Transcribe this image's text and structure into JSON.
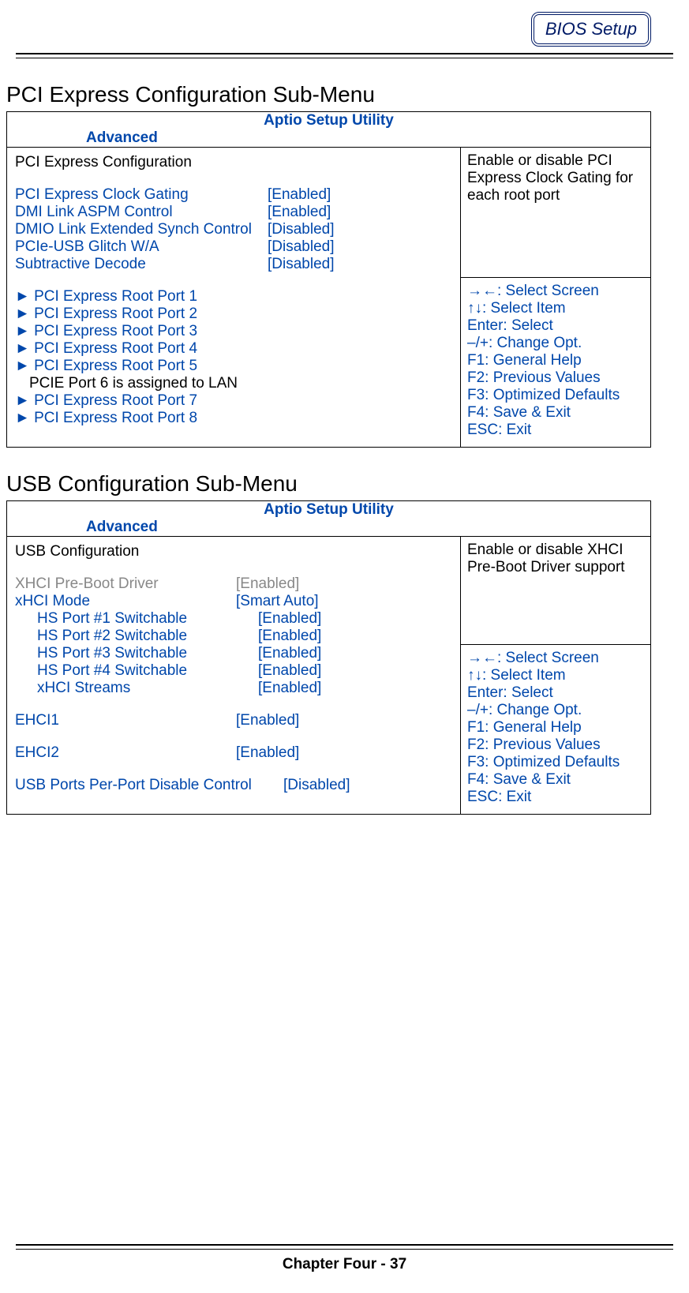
{
  "header": {
    "badge": "BIOS Setup"
  },
  "section1": {
    "title": "PCI Express Configuration Sub-Menu",
    "utility_title": "Aptio Setup Utility",
    "tab": "Advanced",
    "subtitle": "PCI Express Configuration",
    "items": {
      "clock_gating": {
        "label": "PCI Express Clock Gating",
        "value": "[Enabled]"
      },
      "dmi_aspm": {
        "label": "DMI Link ASPM Control",
        "value": "[Enabled]"
      },
      "dmio_ext": {
        "label": "DMIO Link Extended Synch Control",
        "value": "[Disabled]"
      },
      "pcie_usb": {
        "label": "PCIe-USB Glitch W/A",
        "value": "[Disabled]"
      },
      "subtractive": {
        "label": "Subtractive Decode",
        "value": "[Disabled]"
      },
      "port1": "► PCI Express Root Port 1",
      "port2": "► PCI Express Root Port 2",
      "port3": "► PCI Express Root Port 3",
      "port4": "► PCI Express Root Port 4",
      "port5": "► PCI Express Root Port 5",
      "port6": "PCIE Port 6 is assigned to LAN",
      "port7": "► PCI Express Root Port 7",
      "port8": "► PCI Express Root Port 8"
    },
    "help": "Enable or disable PCI Express Clock Gating for each root port",
    "hints": {
      "screen": "→←: Select Screen",
      "item": "↑↓: Select Item",
      "select": "Enter: Select",
      "change": "–/+: Change Opt.",
      "f1": "F1: General Help",
      "f2": "F2: Previous Values",
      "f3": "F3: Optimized Defaults",
      "f4": "F4: Save & Exit",
      "esc": "ESC: Exit"
    }
  },
  "section2": {
    "title": "USB Configuration Sub-Menu",
    "utility_title": "Aptio Setup Utility",
    "tab": "Advanced",
    "subtitle": "USB Configuration",
    "items": {
      "xhci_preboot": {
        "label": "XHCI Pre-Boot Driver",
        "value": "[Enabled]"
      },
      "xhci_mode": {
        "label": "xHCI Mode",
        "value": "[Smart Auto]"
      },
      "hs1": {
        "label": "HS Port #1 Switchable",
        "value": "[Enabled]"
      },
      "hs2": {
        "label": "HS Port #2 Switchable",
        "value": "[Enabled]"
      },
      "hs3": {
        "label": "HS Port #3 Switchable",
        "value": "[Enabled]"
      },
      "hs4": {
        "label": "HS Port #4 Switchable",
        "value": "[Enabled]"
      },
      "xhci_streams": {
        "label": "xHCI Streams",
        "value": "[Enabled]"
      },
      "ehci1": {
        "label": "EHCI1",
        "value": "[Enabled]"
      },
      "ehci2": {
        "label": "EHCI2",
        "value": "[Enabled]"
      },
      "per_port": {
        "label": "USB Ports Per-Port Disable Control",
        "value": "[Disabled]"
      }
    },
    "help": "Enable or disable XHCI Pre-Boot Driver support",
    "hints": {
      "screen": "→←: Select Screen",
      "item": "↑↓: Select Item",
      "select": "Enter: Select",
      "change": "–/+: Change Opt.",
      "f1": "F1: General Help",
      "f2": "F2: Previous Values",
      "f3": "F3: Optimized Defaults",
      "f4": "F4: Save & Exit",
      "esc": "ESC: Exit"
    }
  },
  "footer": "Chapter Four - 37"
}
